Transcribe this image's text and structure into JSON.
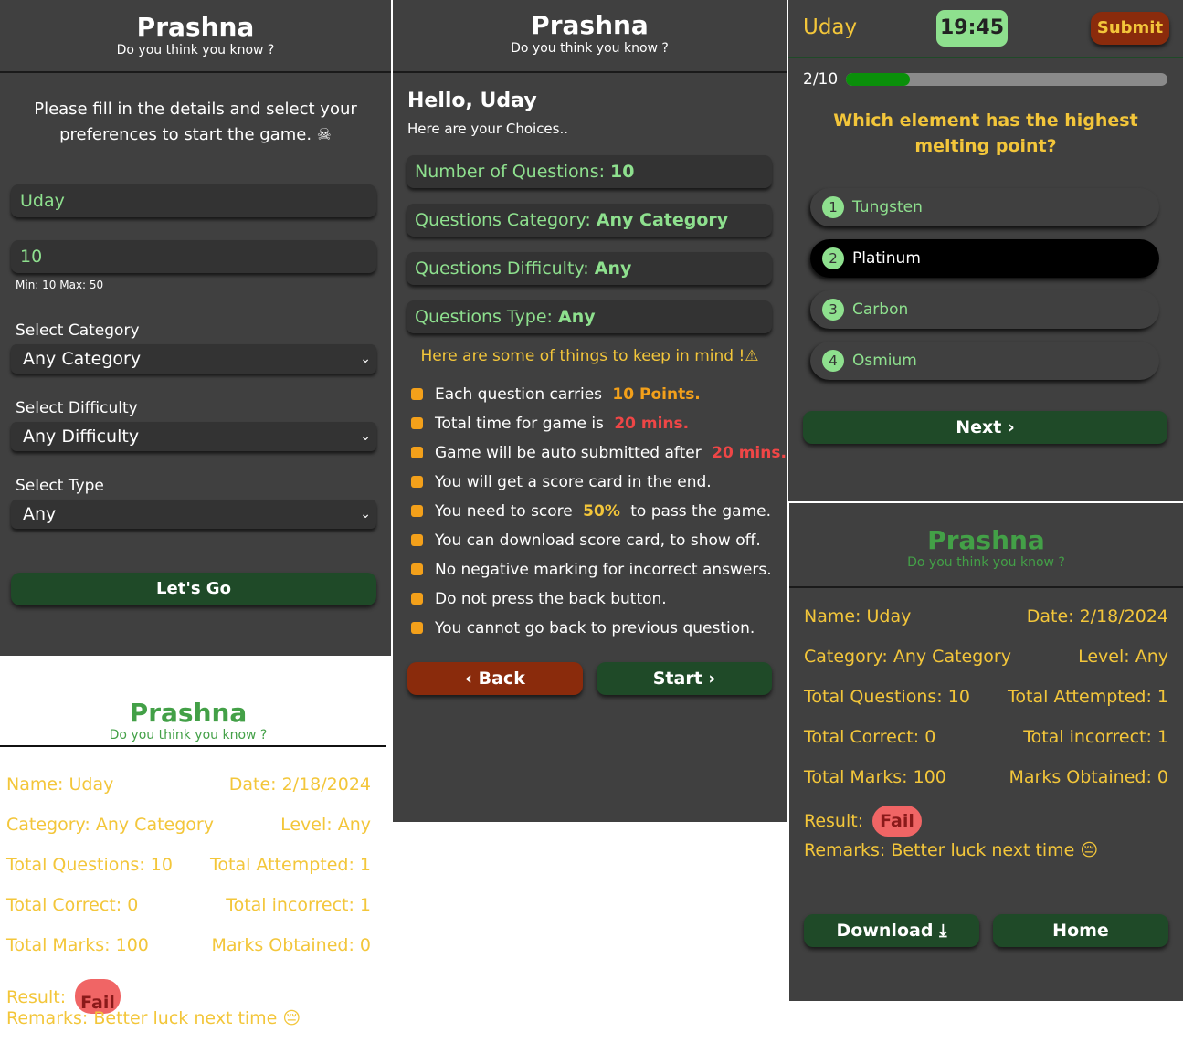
{
  "app": {
    "title": "Prashna",
    "subtitle": "Do you think you know ?"
  },
  "setup": {
    "intro": "Please fill in the details and select your preferences to start the game. ☠",
    "name_value": "Uday",
    "count_value": "10",
    "count_hint": "Min: 10 Max: 50",
    "category_label": "Select Category",
    "category_value": "Any Category",
    "difficulty_label": "Select Difficulty",
    "difficulty_value": "Any Difficulty",
    "type_label": "Select Type",
    "type_value": "Any",
    "go_label": "Let's Go"
  },
  "rules": {
    "hello": "Hello, Uday",
    "choices_text": "Here are your Choices..",
    "choices": [
      {
        "label": "Number of Questions:",
        "value": "10"
      },
      {
        "label": "Questions Category:",
        "value": "Any Category"
      },
      {
        "label": "Questions Difficulty:",
        "value": "Any"
      },
      {
        "label": "Questions Type:",
        "value": "Any"
      }
    ],
    "keep_in_mind": "Here are some of things to keep in mind !⚠",
    "items": [
      {
        "text": "Each question carries ",
        "hl": "10 Points.",
        "style": "hl-or",
        "after": ""
      },
      {
        "text": "Total time for game is ",
        "hl": "20 mins.",
        "style": "hl-red",
        "after": ""
      },
      {
        "text": "Game will be auto submitted after ",
        "hl": "20 mins.",
        "style": "hl-red",
        "after": ""
      },
      {
        "text": "You will get a score card in the end.",
        "hl": "",
        "style": "",
        "after": ""
      },
      {
        "text": "You need to score ",
        "hl": "50%",
        "style": "hl-yel",
        "after": " to pass the game."
      },
      {
        "text": "You can download score card, to show off.",
        "hl": "",
        "style": "",
        "after": ""
      },
      {
        "text": "No negative marking for incorrect answers.",
        "hl": "",
        "style": "",
        "after": ""
      },
      {
        "text": "Do not press the back button.",
        "hl": "",
        "style": "",
        "after": ""
      },
      {
        "text": "You cannot go back to previous question.",
        "hl": "",
        "style": "",
        "after": ""
      }
    ],
    "back_label": "Back",
    "start_label": "Start"
  },
  "quiz": {
    "user": "Uday",
    "timer": "19:45",
    "submit_label": "Submit",
    "progress_text": "2/10",
    "progress_fraction": 0.2,
    "question": "Which element has the highest melting point?",
    "options": [
      {
        "num": "1",
        "text": "Tungsten",
        "selected": false
      },
      {
        "num": "2",
        "text": "Platinum",
        "selected": true
      },
      {
        "num": "3",
        "text": "Carbon",
        "selected": false
      },
      {
        "num": "4",
        "text": "Osmium",
        "selected": false
      }
    ],
    "next_label": "Next"
  },
  "result": {
    "name": "Name: Uday",
    "date": "Date: 2/18/2024",
    "category": "Category: Any Category",
    "level": "Level: Any",
    "total_questions": "Total Questions: 10",
    "total_attempted": "Total Attempted: 1",
    "total_correct": "Total Correct: 0",
    "total_incorrect": "Total incorrect: 1",
    "total_marks": "Total Marks: 100",
    "marks_obtained": "Marks Obtained: 0",
    "result_label": "Result:",
    "result_value": "Fail",
    "remarks": "Remarks: Better luck next time 😔",
    "download_label": "Download",
    "home_label": "Home"
  },
  "colors": {
    "panel": "#404040",
    "accent_green": "#8ee08e",
    "accent_yellow": "#f3c63a",
    "button_green": "#1f4a28",
    "button_red": "#8a2b0c",
    "fail_badge": "#f06565"
  }
}
